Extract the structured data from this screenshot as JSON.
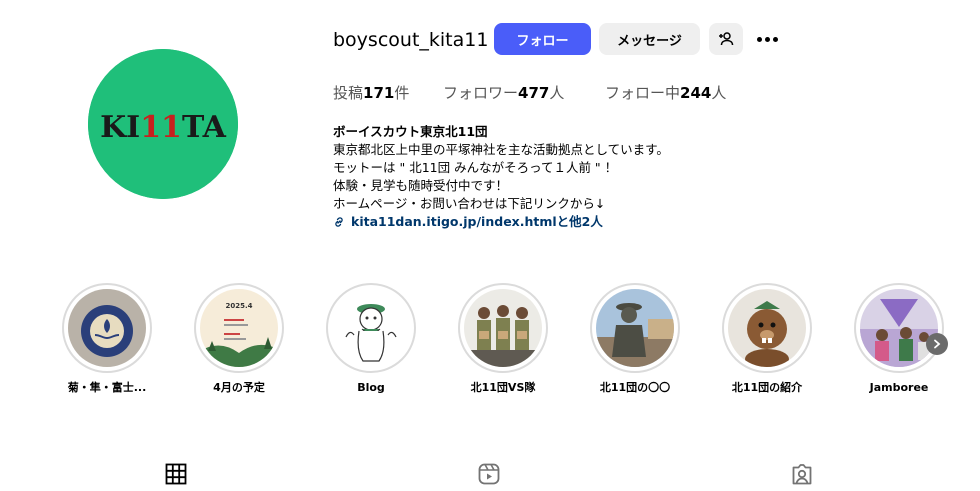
{
  "profile": {
    "username": "boyscout_kita11",
    "avatar_text": "KI11TA",
    "buttons": {
      "follow": "フォロー",
      "message": "メッセージ"
    },
    "stats": {
      "posts_label": "投稿",
      "posts_value": "171",
      "posts_unit": "件",
      "followers_label": "フォロワー",
      "followers_value": "477",
      "followers_unit": "人",
      "following_label": "フォロー中",
      "following_value": "244",
      "following_unit": "人"
    },
    "bio": {
      "name": "ボーイスカウト東京北11団",
      "line1": "東京都北区上中里の平塚神社を主な活動拠点としています。",
      "line2": "モットーは \" 北11団 みんながそろって１人前 \" ！",
      "line3": "体験・見学も随時受付中です！",
      "line4": "ホームページ・お問い合わせは下記リンクから↓",
      "link": "kita11dan.itigo.jp/index.htmlと他2人"
    }
  },
  "highlights": [
    {
      "label": "菊・隼・富士..."
    },
    {
      "label": "4月の予定",
      "image_text": "2025.4"
    },
    {
      "label": "Blog"
    },
    {
      "label": "北11団VS隊"
    },
    {
      "label": "北11団の〇〇"
    },
    {
      "label": "北11団の紹介"
    },
    {
      "label": "Jamboree"
    }
  ],
  "tabs": [
    {
      "icon": "grid-icon"
    },
    {
      "icon": "reels-icon"
    },
    {
      "icon": "tagged-icon"
    }
  ],
  "colors": {
    "follow_button": "#4a5df9",
    "avatar_bg": "#1fbf7a",
    "link": "#00376b"
  }
}
